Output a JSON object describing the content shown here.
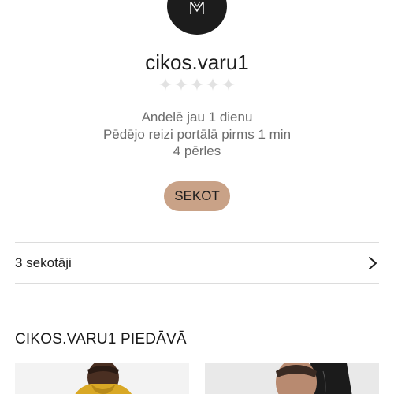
{
  "profile": {
    "avatar_icon": "brand-logo-monogram",
    "username": "cikos.varu1",
    "rating": {
      "stars_filled": 0,
      "stars_total": 5,
      "icon": "star-icon"
    },
    "info_lines": [
      "Andelē jau 1 dienu",
      "Pēdējo reizi portālā pirms 1 min",
      "4 pērles"
    ],
    "follow_label": "SEKOT"
  },
  "followers": {
    "label": "3 sekotāji",
    "icon": "chevron-right-icon"
  },
  "listings": {
    "title": "CIKOS.VARU1 PIEDĀVĀ"
  },
  "colors": {
    "accent": "#c9a287",
    "avatar_bg": "#1c1c1c",
    "text_muted": "#6b6b6b",
    "star_empty": "#e2e2e2",
    "divider": "#dcdcdc"
  }
}
